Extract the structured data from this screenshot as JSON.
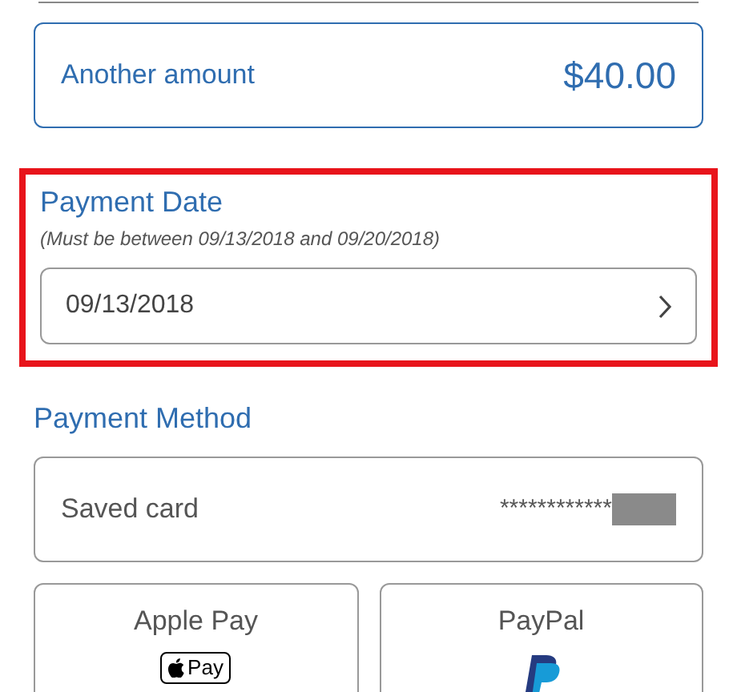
{
  "amount_options": [
    {
      "label": "Another amount",
      "value": "$40.00",
      "selected": true
    }
  ],
  "payment_date": {
    "title": "Payment Date",
    "note": "(Must be between 09/13/2018 and 09/20/2018)",
    "value": "09/13/2018",
    "highlighted": true
  },
  "payment_method": {
    "title": "Payment Method",
    "saved_card": {
      "label": "Saved card",
      "masked_number": "************",
      "selected": false
    },
    "options": [
      {
        "kind": "apple_pay",
        "label": "Apple Pay",
        "badge_text": "Pay",
        "selected": false
      },
      {
        "kind": "paypal",
        "label": "PayPal",
        "selected": false
      }
    ]
  }
}
